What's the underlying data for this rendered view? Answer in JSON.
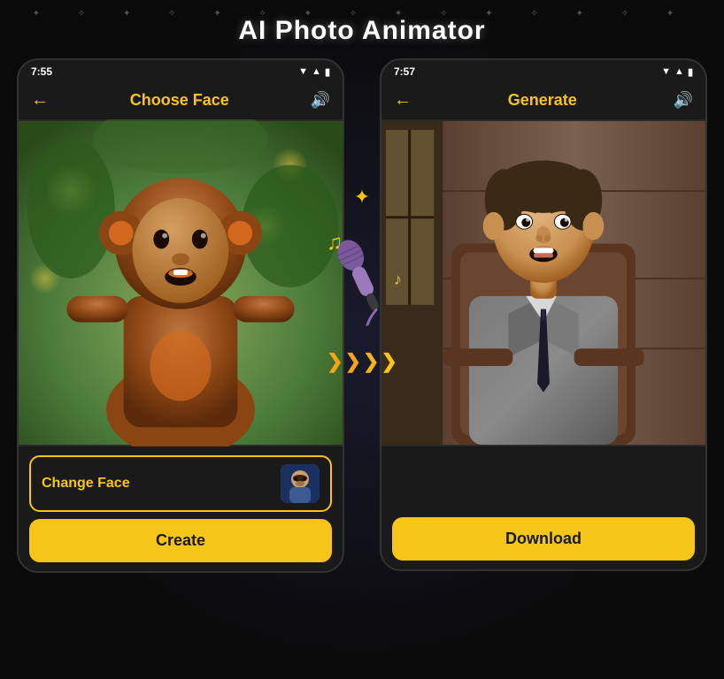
{
  "app": {
    "title": "AI Photo Animator",
    "stars_decorative": "✦ ✧ ✦ ✧ ✦"
  },
  "phone_left": {
    "status_time": "7:55",
    "title": "Choose Face",
    "back_icon": "←",
    "sound_icon": "🔊",
    "change_face_label": "Change Face",
    "create_label": "Create"
  },
  "phone_right": {
    "status_time": "7:57",
    "title": "Generate",
    "back_icon": "←",
    "sound_icon": "🔊",
    "download_label": "Download"
  },
  "overlay": {
    "music_note_1": "♪",
    "music_note_2": "♫",
    "sparkle": "✦",
    "arrows": "❯❯❯❯"
  },
  "colors": {
    "accent": "#f5c518",
    "dark_bg": "#1a1a1a",
    "text_light": "#ffffff",
    "phone_border": "#333333"
  }
}
